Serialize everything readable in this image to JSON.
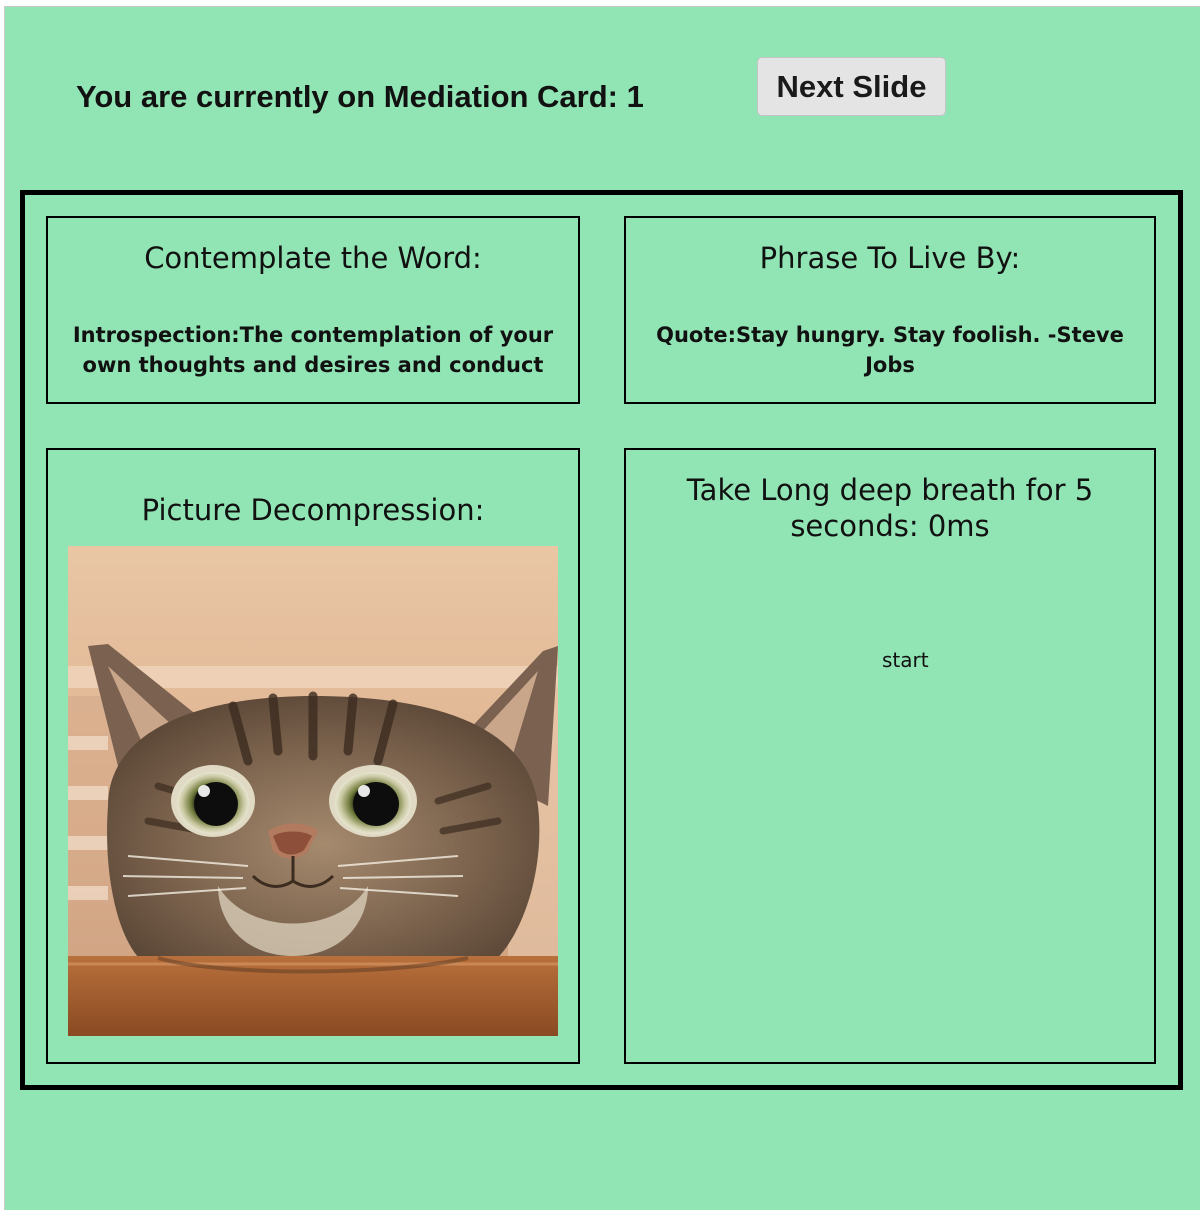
{
  "header": {
    "status_text": "You are currently on Mediation Card: 1",
    "next_button_label": "Next Slide"
  },
  "cards": {
    "word": {
      "title": "Contemplate the Word:",
      "body": "Introspection:The contemplation of your own thoughts and desires and conduct"
    },
    "phrase": {
      "title": "Phrase To Live By:",
      "body": "Quote:Stay hungry. Stay foolish. -Steve Jobs"
    },
    "picture": {
      "title": "Picture Decompression:",
      "image_subject": "tabby cat peeking over a table"
    },
    "breath": {
      "title": "Take Long deep breath for 5 seconds: 0ms",
      "start_label": "start"
    }
  },
  "colors": {
    "background": "#91e4b4",
    "border": "#000000",
    "button": "#e4e4e4"
  }
}
